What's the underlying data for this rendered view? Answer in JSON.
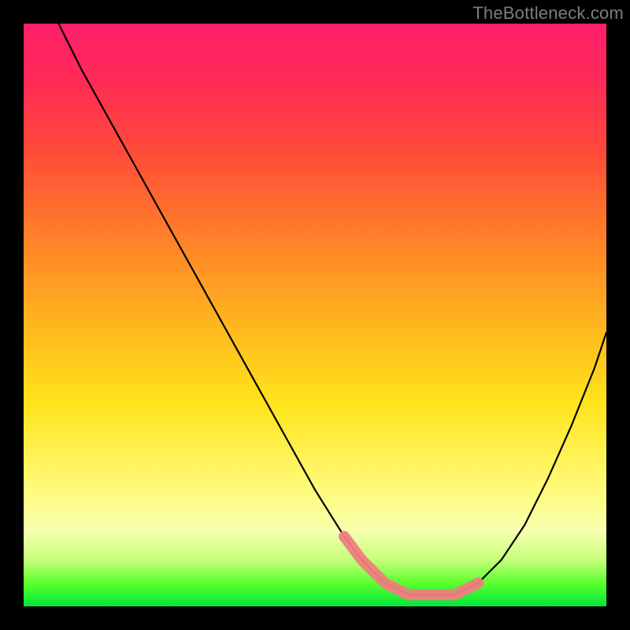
{
  "watermark": "TheBottleneck.com",
  "chart_data": {
    "type": "line",
    "title": "",
    "xlabel": "",
    "ylabel": "",
    "xlim": [
      0,
      100
    ],
    "ylim": [
      0,
      100
    ],
    "grid": false,
    "series": [
      {
        "name": "curve",
        "color": "#000000",
        "x": [
          6,
          10,
          15,
          20,
          25,
          30,
          35,
          40,
          45,
          50,
          55,
          58,
          62,
          66,
          70,
          74,
          78,
          82,
          86,
          90,
          94,
          98,
          100
        ],
        "y": [
          100,
          92,
          83,
          74,
          65,
          56,
          47,
          38,
          29,
          20,
          12,
          8,
          4,
          2,
          2,
          2,
          4,
          8,
          14,
          22,
          31,
          41,
          47
        ]
      },
      {
        "name": "highlight",
        "color": "#f08080",
        "x": [
          55,
          58,
          62,
          66,
          70,
          74,
          78
        ],
        "y": [
          12,
          8,
          4,
          2,
          2,
          2,
          4
        ]
      }
    ]
  }
}
